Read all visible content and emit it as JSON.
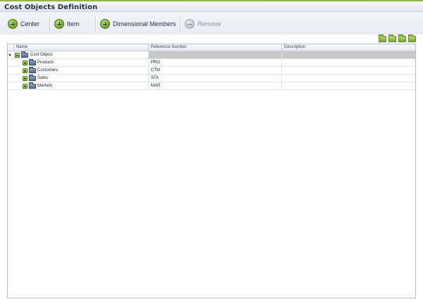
{
  "page": {
    "title": "Cost Objects Definition"
  },
  "toolbar": {
    "center_label": "Center",
    "item_label": "Item",
    "dimensional_members_label": "Dimensional Members",
    "remove_label": "Remove"
  },
  "grid": {
    "columns": {
      "name": "Name",
      "reference_number": "Reference Number",
      "description": "Description"
    },
    "root": {
      "name": "Cost Object",
      "reference_number": "",
      "description": ""
    },
    "rows": [
      {
        "name": "Products",
        "reference_number": "PRO",
        "description": ""
      },
      {
        "name": "Customers",
        "reference_number": "CTM",
        "description": ""
      },
      {
        "name": "Sales",
        "reference_number": "STA",
        "description": ""
      },
      {
        "name": "Markets",
        "reference_number": "MAR",
        "description": ""
      }
    ]
  },
  "icons": {
    "add": "plus-circle-icon",
    "remove": "minus-circle-icon",
    "folder": "folder-icon",
    "mini_toolbar": [
      "folder-add-icon",
      "folder-open-icon",
      "folder-move-icon",
      "folder-split-icon"
    ]
  },
  "colors": {
    "accent": "#8fb64a",
    "title": "#1f2d4a",
    "selected_row": "#c8c8c8"
  }
}
